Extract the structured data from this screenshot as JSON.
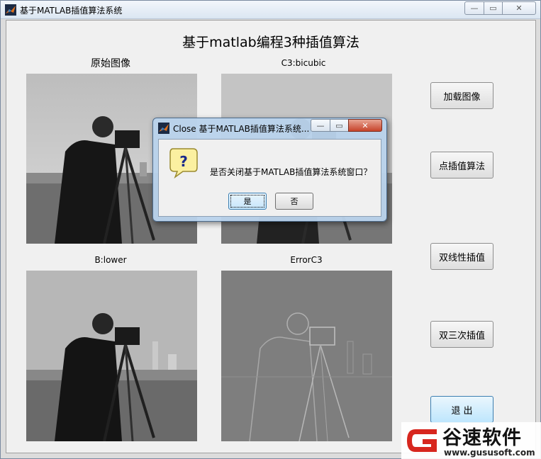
{
  "window": {
    "title": "基于MATLAB插值算法系统",
    "min_glyph": "—",
    "max_glyph": "▭",
    "close_glyph": "✕"
  },
  "main": {
    "heading": "基于matlab编程3种插值算法",
    "panels": {
      "original_label": "原始图像",
      "bicubic_label": "C3:bicubic",
      "lower_label": "B:lower",
      "error_label": "ErrorC3"
    }
  },
  "buttons": {
    "load": "加载图像",
    "nearest": "点插值算法",
    "bilinear": "双线性插值",
    "bicubic": "双三次插值",
    "exit": "退  出"
  },
  "dialog": {
    "title": "Close 基于MATLAB插值算法系统...",
    "message": "是否关闭基于MATLAB插值算法系统窗口？",
    "yes_label": "是",
    "no_label": "否",
    "icon": "question-icon",
    "min_glyph": "—",
    "max_glyph": "▭",
    "close_glyph": "✕"
  },
  "watermark": {
    "name": "谷速软件",
    "url": "www.gususoft.com",
    "logo_letter": "G"
  },
  "colors": {
    "accent": "#3c7fb1",
    "watermark_red": "#d7261e"
  }
}
